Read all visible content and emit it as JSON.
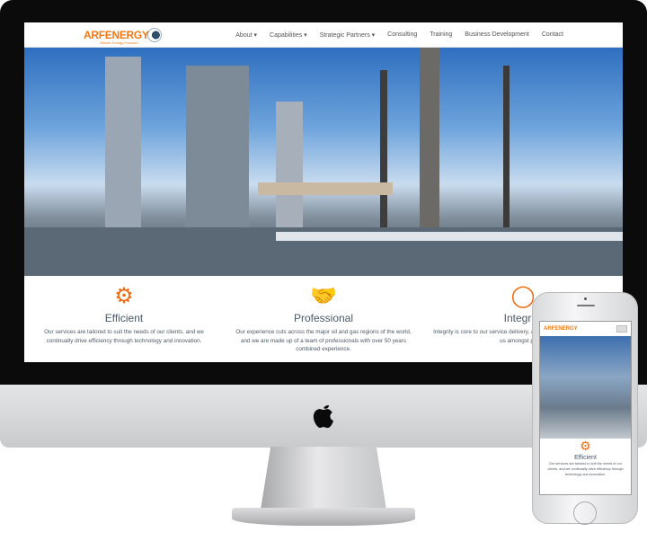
{
  "site": {
    "logo_text": "ARFENERGY",
    "logo_tagline": "African Energy Focused"
  },
  "nav": {
    "items": [
      "About ▾",
      "Capabilities ▾",
      "Strategic Partners ▾",
      "Consulting",
      "Training",
      "Business Development",
      "Contact"
    ]
  },
  "features": [
    {
      "icon": "gears-icon",
      "glyph": "⚙",
      "title": "Efficient",
      "text": "Our services are tailored to suit the needs of our clients, and we continually drive efficiency through technology and innovation."
    },
    {
      "icon": "handshake-icon",
      "glyph": "🤝",
      "title": "Professional",
      "text": "Our experience cuts across the major oil and gas regions of the world, and we are made up of a team of professionals with over 50 years combined experience."
    },
    {
      "icon": "integrity-icon",
      "glyph": "◯",
      "title": "Integrity",
      "text": "Integrity is core to our service delivery, and this has continually elevated us amongst peers."
    }
  ],
  "accent": "#f06a10"
}
